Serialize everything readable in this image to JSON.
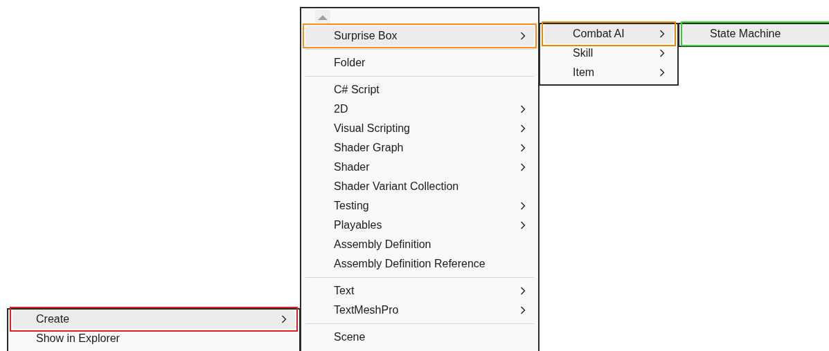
{
  "menus": [
    {
      "items": [
        {
          "kind": "item",
          "label": "Create",
          "submenu": true,
          "selected": true,
          "color": "#e02020"
        },
        {
          "kind": "item",
          "label": "Show in Explorer",
          "submenu": false,
          "selected": false
        }
      ]
    },
    {
      "items": [
        {
          "kind": "scroll_up"
        },
        {
          "kind": "item",
          "label": "Surprise Box",
          "submenu": true,
          "selected": true,
          "color": "#ff8c1a"
        },
        {
          "kind": "separator"
        },
        {
          "kind": "item",
          "label": "Folder",
          "submenu": false,
          "selected": false
        },
        {
          "kind": "separator"
        },
        {
          "kind": "item",
          "label": "C# Script",
          "submenu": false,
          "selected": false
        },
        {
          "kind": "item",
          "label": "2D",
          "submenu": true,
          "selected": false
        },
        {
          "kind": "item",
          "label": "Visual Scripting",
          "submenu": true,
          "selected": false
        },
        {
          "kind": "item",
          "label": "Shader Graph",
          "submenu": true,
          "selected": false
        },
        {
          "kind": "item",
          "label": "Shader",
          "submenu": true,
          "selected": false
        },
        {
          "kind": "item",
          "label": "Shader Variant Collection",
          "submenu": false,
          "selected": false
        },
        {
          "kind": "item",
          "label": "Testing",
          "submenu": true,
          "selected": false
        },
        {
          "kind": "item",
          "label": "Playables",
          "submenu": true,
          "selected": false
        },
        {
          "kind": "item",
          "label": "Assembly Definition",
          "submenu": false,
          "selected": false
        },
        {
          "kind": "item",
          "label": "Assembly Definition Reference",
          "submenu": false,
          "selected": false
        },
        {
          "kind": "separator"
        },
        {
          "kind": "item",
          "label": "Text",
          "submenu": true,
          "selected": false
        },
        {
          "kind": "item",
          "label": "TextMeshPro",
          "submenu": true,
          "selected": false
        },
        {
          "kind": "separator"
        },
        {
          "kind": "item",
          "label": "Scene",
          "submenu": false,
          "selected": false
        }
      ]
    },
    {
      "items": [
        {
          "kind": "item",
          "label": "Combat AI",
          "submenu": true,
          "selected": true,
          "color": "#e68a00"
        },
        {
          "kind": "item",
          "label": "Skill",
          "submenu": true,
          "selected": false
        },
        {
          "kind": "item",
          "label": "Item",
          "submenu": true,
          "selected": false
        }
      ]
    },
    {
      "items": [
        {
          "kind": "item",
          "label": "State Machine",
          "submenu": false,
          "selected": true,
          "color": "#22dd22"
        }
      ]
    }
  ]
}
